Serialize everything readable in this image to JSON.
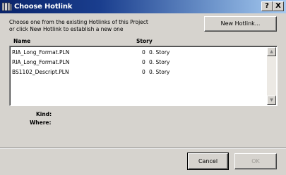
{
  "window": {
    "title": "Choose Hotlink"
  },
  "titlebar": {
    "help_label": "?",
    "close_label": "X"
  },
  "instructions": {
    "line1": "Choose one from the existing Hotlinks of this Project",
    "line2": "or click New Hotlink to establish a new one"
  },
  "buttons": {
    "new_hotlink": "New Hotlink...",
    "cancel": "Cancel",
    "ok": "OK"
  },
  "list": {
    "headers": {
      "name": "Name",
      "story": "Story"
    },
    "rows": [
      {
        "name": "RIA_Long_Format.PLN",
        "story_num": "0",
        "story_name": "0. Story"
      },
      {
        "name": "RIA_Long_Format.PLN",
        "story_num": "0",
        "story_name": "0. Story"
      },
      {
        "name": "BS1102_Descript.PLN",
        "story_num": "0",
        "story_name": "0. Story"
      }
    ]
  },
  "details": {
    "kind_label": "Kind:",
    "where_label": "Where:"
  },
  "scrollbar": {
    "up_icon": "scroll-up-arrow",
    "down_icon": "scroll-down-arrow"
  }
}
